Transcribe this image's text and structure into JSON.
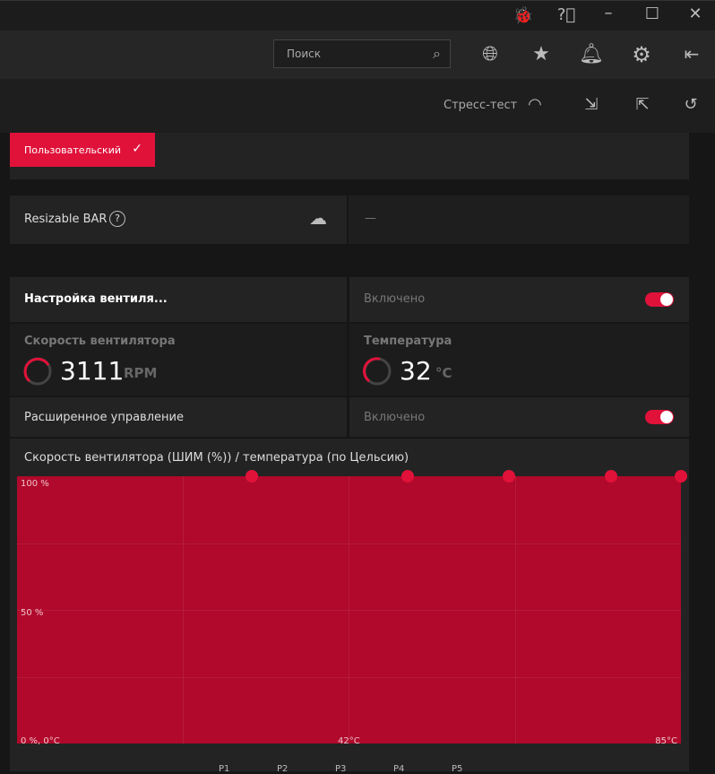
{
  "titlebar": {
    "icons": [
      "bug-icon",
      "help-icon",
      "minimize-icon",
      "maximize-icon",
      "close-icon"
    ]
  },
  "topbar": {
    "search_placeholder": "Поиск",
    "icons": [
      "globe-icon",
      "star-icon",
      "bell-icon",
      "gear-icon",
      "sidebar-toggle-icon"
    ]
  },
  "subbar": {
    "stress_test": "Стресс-тест",
    "icons": [
      "gauge-icon",
      "import-icon",
      "export-icon",
      "reset-icon"
    ]
  },
  "profile": {
    "label": "Пользовательский"
  },
  "resizable_bar": {
    "label": "Resizable BAR",
    "value": "—"
  },
  "fan": {
    "title": "Настройка вентиля...",
    "state": "Включено",
    "enabled": true,
    "speed_label": "Скорость вентилятора",
    "speed_value": "3111",
    "speed_unit": "RPM",
    "temp_label": "Температура",
    "temp_value": "32",
    "temp_unit": "°C",
    "advanced_label": "Расширенное управление",
    "advanced_state": "Включено",
    "advanced_enabled": true,
    "chart_title": "Скорость вентилятора (ШИМ (%)) / температура (по Цельсию)"
  },
  "colors": {
    "accent": "#e0123a",
    "chart_fill": "#b0092b"
  },
  "chart_data": {
    "type": "line",
    "title": "Скорость вентилятора (ШИМ (%)) / температура (по Цельсию)",
    "xlim": [
      0,
      85
    ],
    "ylim": [
      0,
      100
    ],
    "tick_labels": {
      "y_top": "100 %",
      "y_mid": "50 %",
      "origin": "0 %, 0°C",
      "x_mid": "42°C",
      "x_max": "85°C"
    },
    "points": [
      {
        "name": "P1",
        "x": 30,
        "y": 100
      },
      {
        "name": "P2",
        "x": 50,
        "y": 100
      },
      {
        "name": "P3",
        "x": 63,
        "y": 100
      },
      {
        "name": "P4",
        "x": 76,
        "y": 100
      },
      {
        "name": "P5",
        "x": 85,
        "y": 100
      }
    ]
  }
}
